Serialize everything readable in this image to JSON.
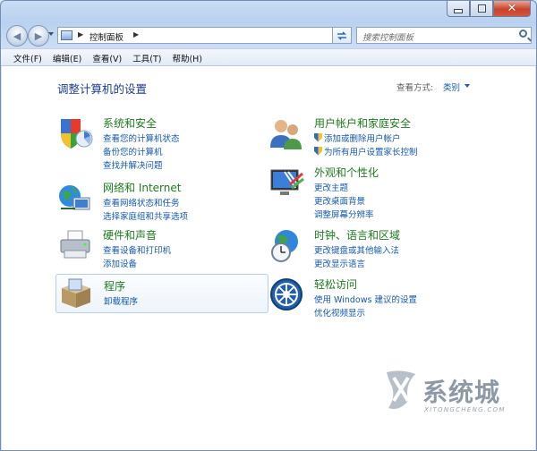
{
  "address": {
    "crumb": "控制面板"
  },
  "search": {
    "placeholder": "搜索控制面板"
  },
  "menu": [
    {
      "label": "文件(F)"
    },
    {
      "label": "编辑(E)"
    },
    {
      "label": "查看(V)"
    },
    {
      "label": "工具(T)"
    },
    {
      "label": "帮助(H)"
    }
  ],
  "main": {
    "title": "调整计算机的设置",
    "view_by_label": "查看方式:",
    "view_by_value": "类别"
  },
  "categories": [
    {
      "title": "系统和安全",
      "icon": "shield-icon",
      "links": [
        {
          "text": "查看您的计算机状态"
        },
        {
          "text": "备份您的计算机"
        },
        {
          "text": "查找并解决问题"
        }
      ]
    },
    {
      "title": "网络和 Internet",
      "icon": "network-globe-icon",
      "links": [
        {
          "text": "查看网络状态和任务"
        },
        {
          "text": "选择家庭组和共享选项"
        }
      ]
    },
    {
      "title": "硬件和声音",
      "icon": "printer-icon",
      "links": [
        {
          "text": "查看设备和打印机"
        },
        {
          "text": "添加设备"
        }
      ]
    },
    {
      "title": "程序",
      "icon": "programs-box-icon",
      "links": [
        {
          "text": "卸载程序"
        }
      ]
    },
    {
      "title": "用户帐户和家庭安全",
      "icon": "users-icon",
      "links": [
        {
          "text": "添加或删除用户帐户",
          "shield": true
        },
        {
          "text": "为所有用户设置家长控制",
          "shield": true
        }
      ]
    },
    {
      "title": "外观和个性化",
      "icon": "monitor-icon",
      "links": [
        {
          "text": "更改主题"
        },
        {
          "text": "更改桌面背景"
        },
        {
          "text": "调整屏幕分辨率"
        }
      ]
    },
    {
      "title": "时钟、语言和区域",
      "icon": "clock-globe-icon",
      "links": [
        {
          "text": "更改键盘或其他输入法"
        },
        {
          "text": "更改显示语言"
        }
      ]
    },
    {
      "title": "轻松访问",
      "icon": "ease-of-access-icon",
      "links": [
        {
          "text": "使用 Windows 建议的设置"
        },
        {
          "text": "优化视频显示"
        }
      ]
    }
  ],
  "watermark": {
    "main": "系统城",
    "sub": "XITONGCHENG.COM"
  }
}
